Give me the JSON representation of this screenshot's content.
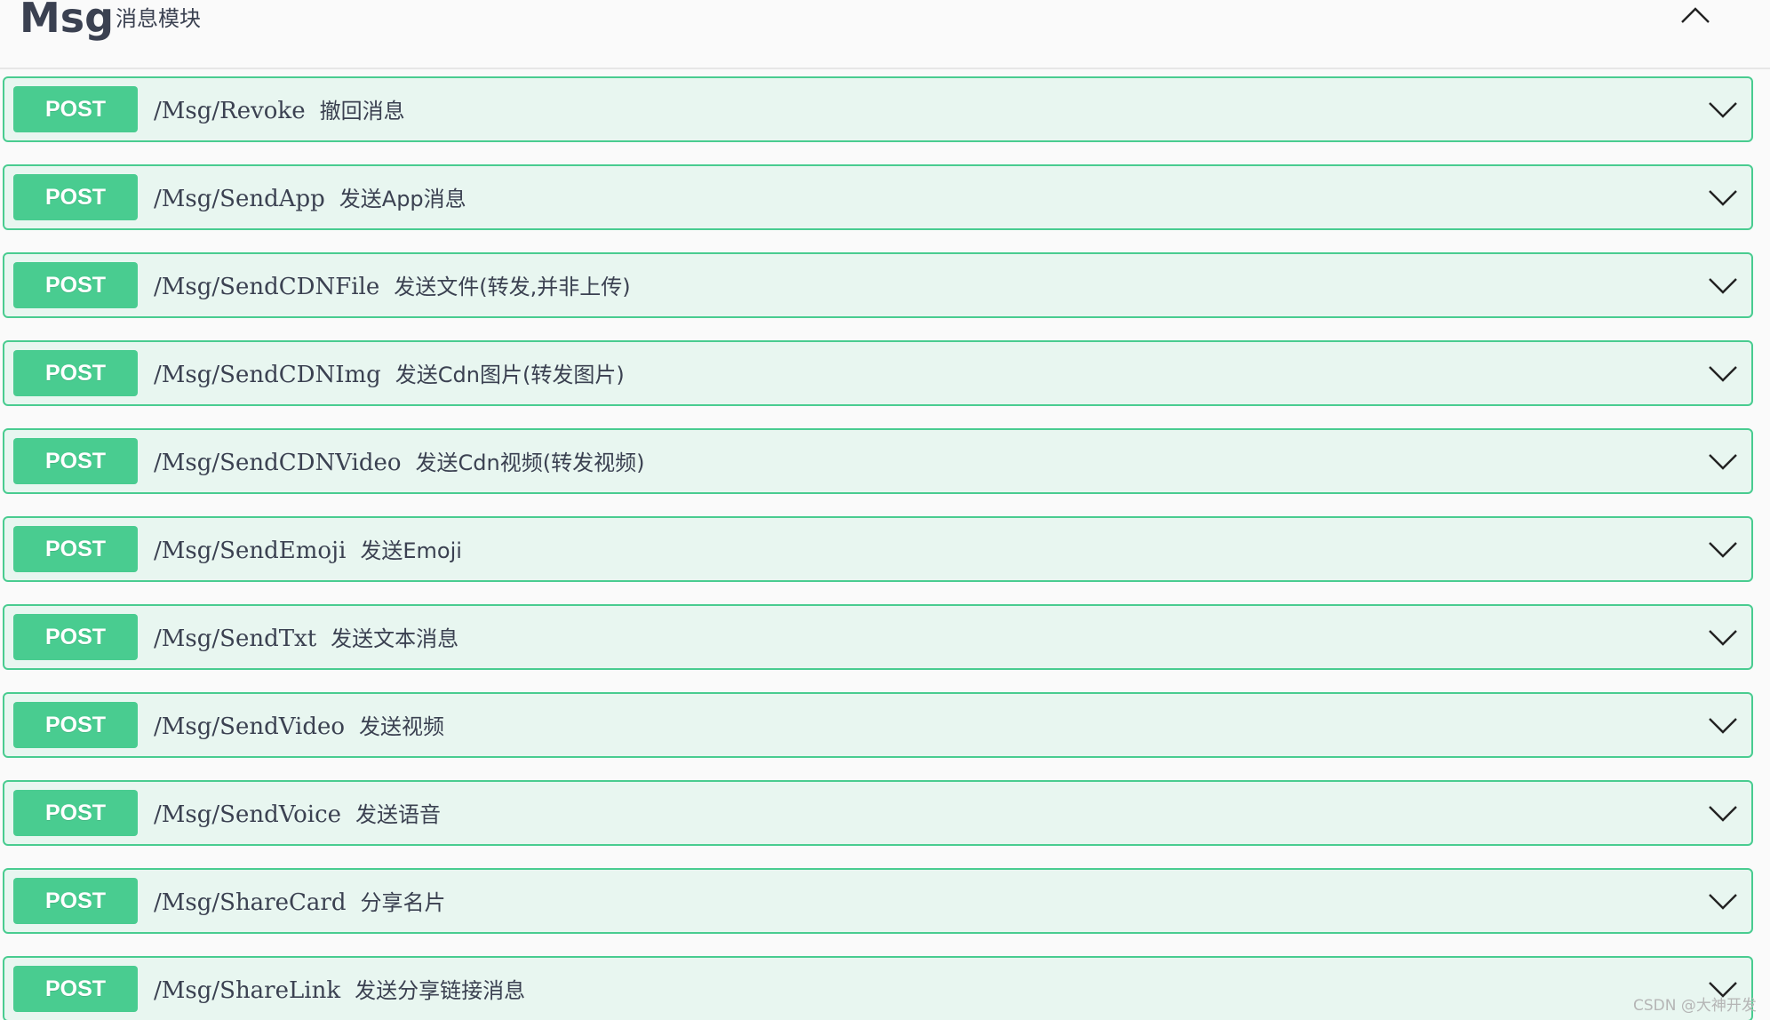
{
  "section": {
    "title": "Msg",
    "description": "消息模块"
  },
  "colors": {
    "post": "#49cc90",
    "post_bg": "#e8f6f0",
    "text": "#3b4151"
  },
  "operations": [
    {
      "method": "POST",
      "path": "/Msg/Revoke",
      "summary": "撤回消息"
    },
    {
      "method": "POST",
      "path": "/Msg/SendApp",
      "summary": "发送App消息"
    },
    {
      "method": "POST",
      "path": "/Msg/SendCDNFile",
      "summary": "发送文件(转发,并非上传)"
    },
    {
      "method": "POST",
      "path": "/Msg/SendCDNImg",
      "summary": "发送Cdn图片(转发图片)"
    },
    {
      "method": "POST",
      "path": "/Msg/SendCDNVideo",
      "summary": "发送Cdn视频(转发视频)"
    },
    {
      "method": "POST",
      "path": "/Msg/SendEmoji",
      "summary": "发送Emoji"
    },
    {
      "method": "POST",
      "path": "/Msg/SendTxt",
      "summary": "发送文本消息"
    },
    {
      "method": "POST",
      "path": "/Msg/SendVideo",
      "summary": "发送视频"
    },
    {
      "method": "POST",
      "path": "/Msg/SendVoice",
      "summary": "发送语音"
    },
    {
      "method": "POST",
      "path": "/Msg/ShareCard",
      "summary": "分享名片"
    },
    {
      "method": "POST",
      "path": "/Msg/ShareLink",
      "summary": "发送分享链接消息"
    }
  ],
  "watermark": "CSDN @大神开发"
}
